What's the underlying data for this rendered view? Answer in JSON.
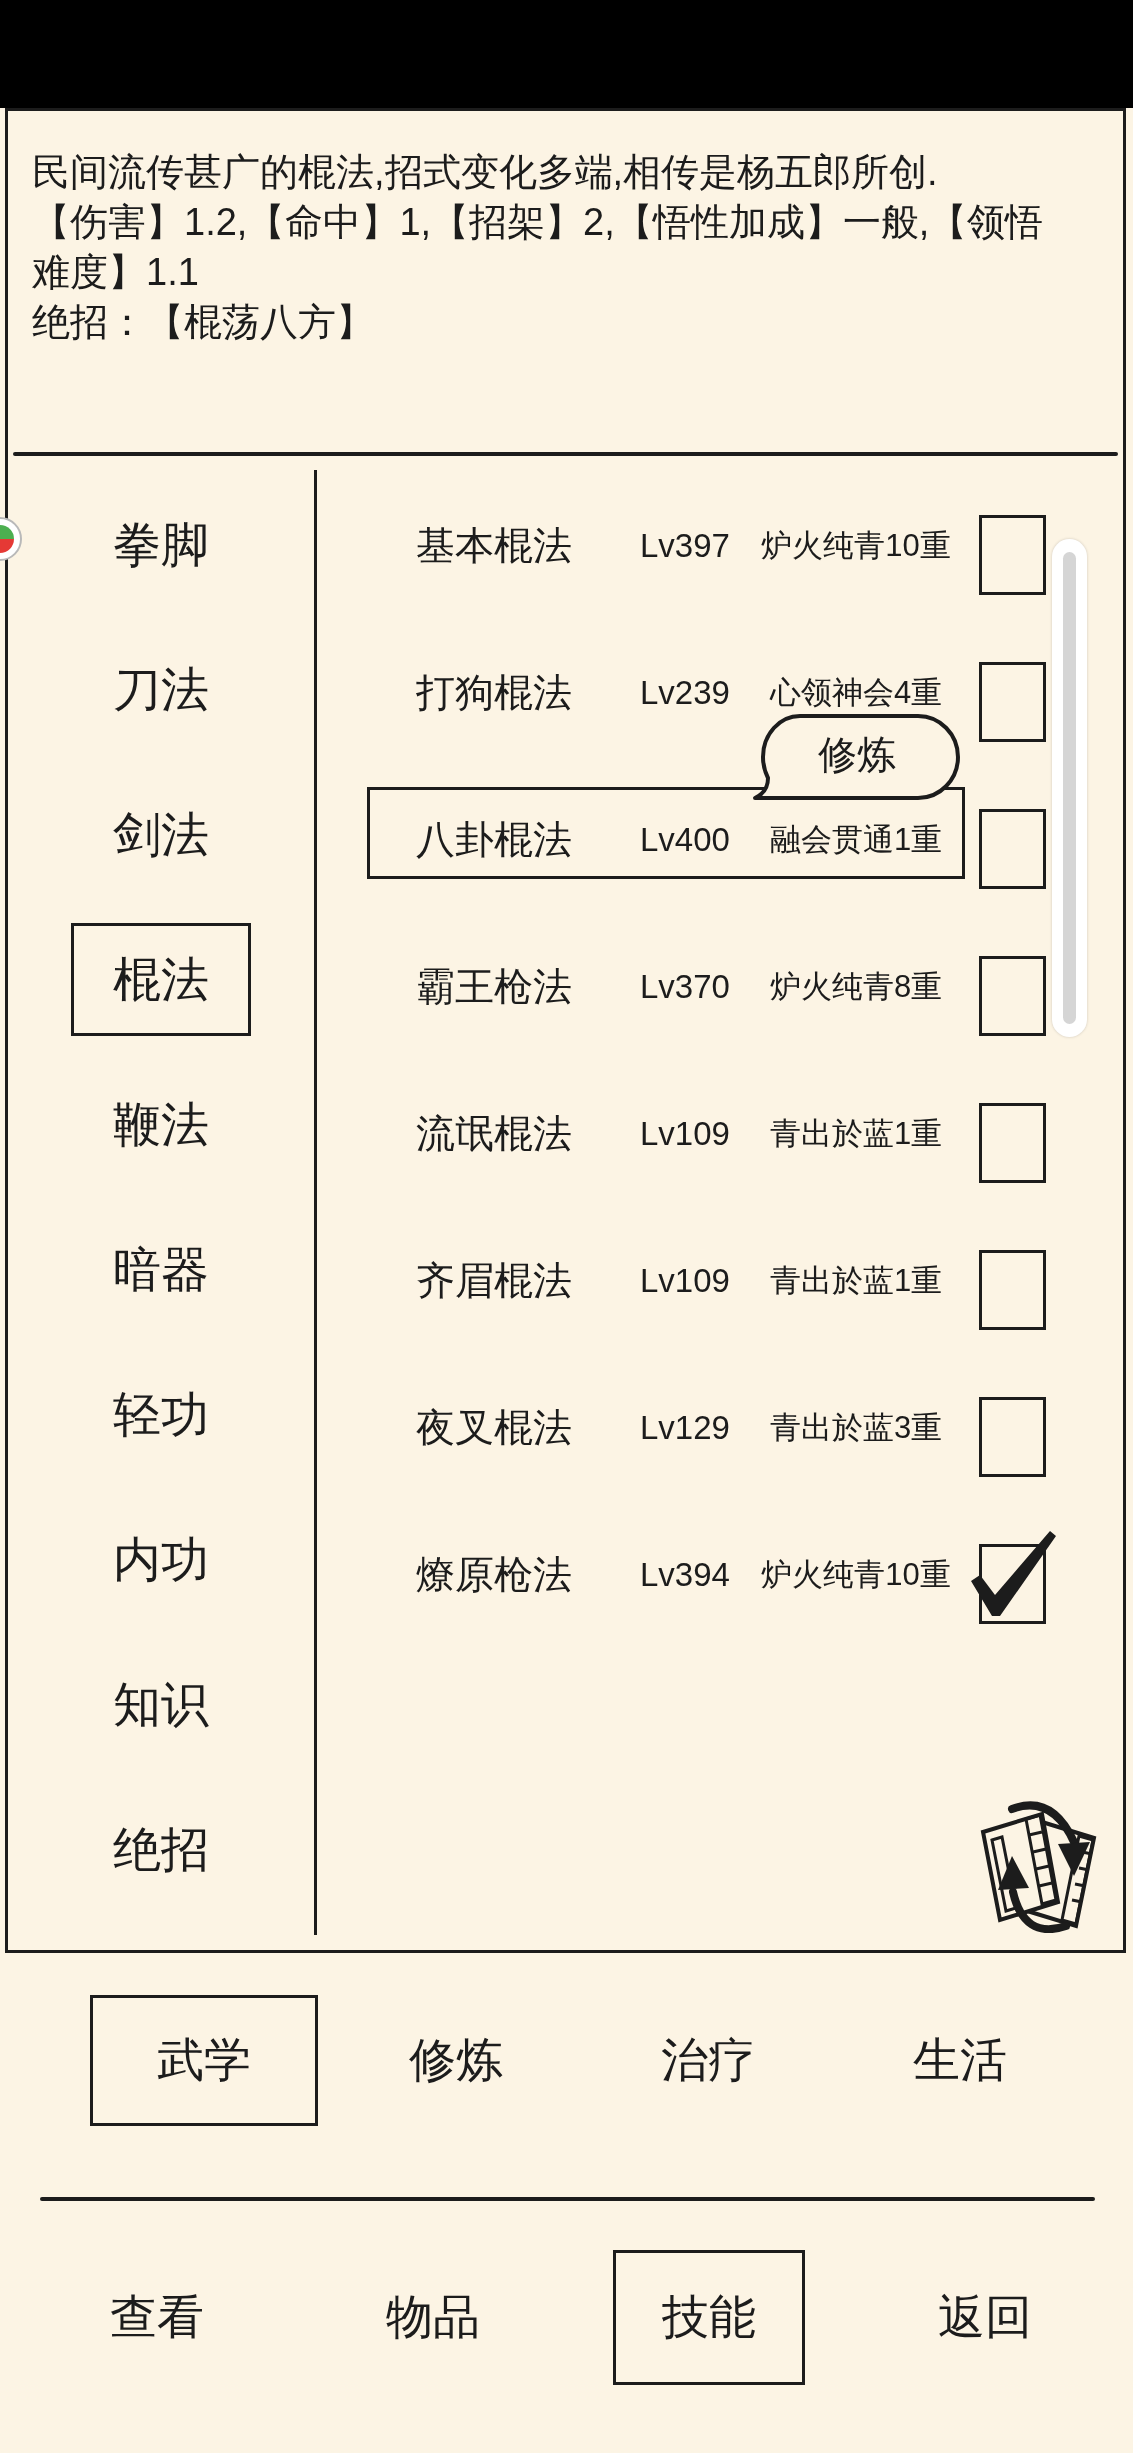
{
  "description": {
    "summary": "民间流传甚广的棍法,招式变化多端,相传是杨五郎所创.",
    "stats": "【伤害】1.2,【命中】1,【招架】2,【悟性加成】一般,【领悟难度】1.1",
    "special_move": "绝招：【棍荡八方】"
  },
  "categories": [
    {
      "label": "拳脚",
      "selected": false
    },
    {
      "label": "刀法",
      "selected": false
    },
    {
      "label": "剑法",
      "selected": false
    },
    {
      "label": "棍法",
      "selected": true
    },
    {
      "label": "鞭法",
      "selected": false
    },
    {
      "label": "暗器",
      "selected": false
    },
    {
      "label": "轻功",
      "selected": false
    },
    {
      "label": "内功",
      "selected": false
    },
    {
      "label": "知识",
      "selected": false
    },
    {
      "label": "绝招",
      "selected": false
    }
  ],
  "skills": [
    {
      "name": "基本棍法",
      "grade": "Lv397",
      "realm": "炉火纯青10重",
      "selected": false,
      "checked": false
    },
    {
      "name": "打狗棍法",
      "grade": "Lv239",
      "realm": "心领神会4重",
      "selected": false,
      "checked": false
    },
    {
      "name": "八卦棍法",
      "grade": "Lv400",
      "realm": "融会贯通1重",
      "selected": true,
      "checked": false
    },
    {
      "name": "霸王枪法",
      "grade": "Lv370",
      "realm": "炉火纯青8重",
      "selected": false,
      "checked": false
    },
    {
      "name": "流氓棍法",
      "grade": "Lv109",
      "realm": "青出於蓝1重",
      "selected": false,
      "checked": false
    },
    {
      "name": "齐眉棍法",
      "grade": "Lv109",
      "realm": "青出於蓝1重",
      "selected": false,
      "checked": false
    },
    {
      "name": "夜叉棍法",
      "grade": "Lv129",
      "realm": "青出於蓝3重",
      "selected": false,
      "checked": false
    },
    {
      "name": "燎原枪法",
      "grade": "Lv394",
      "realm": "炉火纯青10重",
      "selected": false,
      "checked": true
    }
  ],
  "action_bubble": {
    "label": "修炼"
  },
  "section_tabs": [
    {
      "label": "武学",
      "selected": true
    },
    {
      "label": "修炼",
      "selected": false
    },
    {
      "label": "治疗",
      "selected": false
    },
    {
      "label": "生活",
      "selected": false
    }
  ],
  "nav": [
    {
      "label": "查看",
      "selected": false
    },
    {
      "label": "物品",
      "selected": false
    },
    {
      "label": "技能",
      "selected": true
    },
    {
      "label": "返回",
      "selected": false
    }
  ]
}
